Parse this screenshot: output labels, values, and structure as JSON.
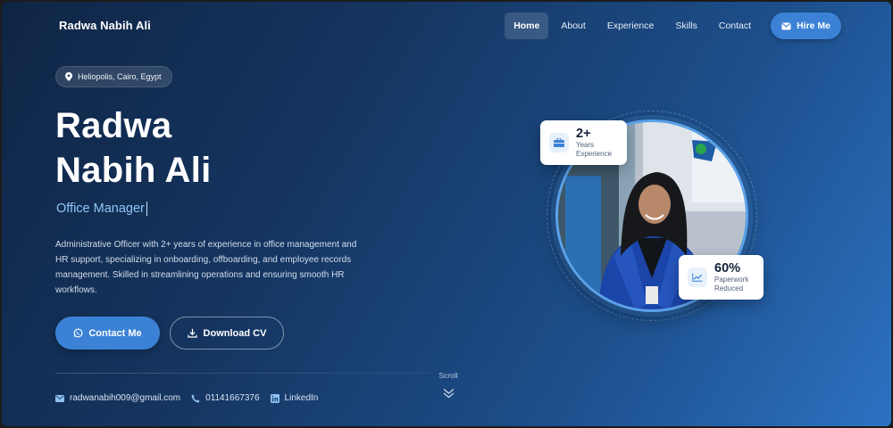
{
  "brand": "Radwa Nabih Ali",
  "nav": {
    "items": [
      "Home",
      "About",
      "Experience",
      "Skills",
      "Contact"
    ],
    "hire_label": "Hire Me"
  },
  "hero": {
    "location": "Heliopolis, Cairo, Egypt",
    "name_line1": "Radwa",
    "name_line2": "Nabih Ali",
    "role": "Office Manager",
    "bio": "Administrative Officer with 2+ years of experience in office management and HR support, specializing in onboarding, offboarding, and employee records management. Skilled in streamlining operations and ensuring smooth HR workflows.",
    "contact_label": "Contact Me",
    "cv_label": "Download CV"
  },
  "contacts": {
    "email": "radwanabih009@gmail.com",
    "phone": "01141667376",
    "linkedin": "LinkedIn"
  },
  "scroll_label": "Scroll",
  "stats": {
    "experience": {
      "value": "2+",
      "label_line1": "Years",
      "label_line2": "Experience"
    },
    "paperwork": {
      "value": "60%",
      "label_line1": "Paperwork",
      "label_line2": "Reduced"
    }
  },
  "colors": {
    "accent": "#3b82d6",
    "role_text": "#8fc6f4"
  }
}
